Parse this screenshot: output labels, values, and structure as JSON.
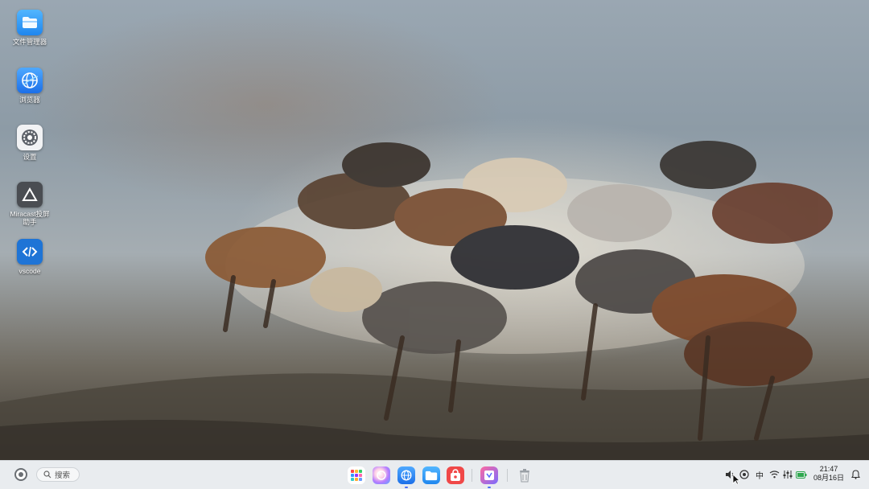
{
  "desktop": {
    "icons": [
      {
        "label": "文件管理器",
        "icon": "folder-icon"
      },
      {
        "label": "浏览器",
        "icon": "browser-globe-icon"
      },
      {
        "label": "设置",
        "icon": "settings-gear-icon"
      },
      {
        "label": "Miracast投屏助手",
        "icon": "miracast-icon"
      },
      {
        "label": "vscode",
        "icon": "vscode-icon"
      }
    ]
  },
  "taskbar": {
    "search_label": "搜索",
    "pinned_apps": [
      {
        "name": "app-launcher",
        "icon": "grid-apps-icon"
      },
      {
        "name": "browser",
        "icon": "browser-globe-icon"
      },
      {
        "name": "file-manager",
        "icon": "folder-icon"
      },
      {
        "name": "store",
        "icon": "store-bag-icon"
      },
      {
        "name": "screenshot-tool",
        "icon": "screenshot-icon"
      },
      {
        "name": "trash",
        "icon": "trash-icon"
      }
    ],
    "tray": {
      "input_method": "中",
      "time": "21:47",
      "date": "08月16日"
    }
  },
  "colors": {
    "taskbar_bg": "#e9ecef",
    "accent_blue": "#2f7cf6",
    "text": "#222222"
  }
}
